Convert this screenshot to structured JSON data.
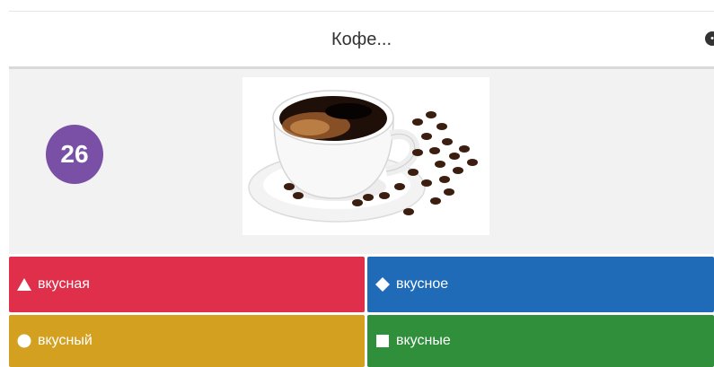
{
  "header": {
    "title": "Кофе...",
    "corner_icon": "notification-badge-icon"
  },
  "timer": {
    "count": "26",
    "color": "#7a4fa6"
  },
  "media": {
    "icon": "coffee-cup-image"
  },
  "answers": [
    {
      "label": "вкусная",
      "shape": "triangle-icon",
      "color": "#e02f4a"
    },
    {
      "label": "вкусное",
      "shape": "diamond-icon",
      "color": "#1f6bb8"
    },
    {
      "label": "вкусный",
      "shape": "circle-icon",
      "color": "#d4a020"
    },
    {
      "label": "вкусные",
      "shape": "square-icon",
      "color": "#2f8f3a"
    }
  ]
}
